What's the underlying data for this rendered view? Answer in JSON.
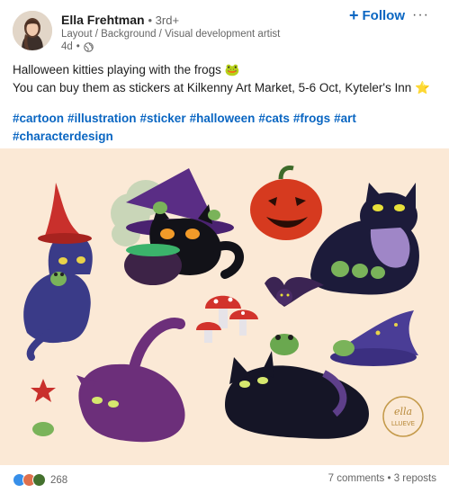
{
  "author": {
    "name": "Ella Frehtman",
    "degree": "3rd+",
    "headline": "Layout / Background / Visual development artist",
    "time": "4d"
  },
  "actions": {
    "follow_label": "Follow",
    "more_label": "···"
  },
  "post": {
    "line1": "Halloween kitties playing with the frogs",
    "line1_emoji": "🐸",
    "line2": "You can buy them as stickers at Kilkenny Art Market, 5-6 Oct, Kyteler's Inn",
    "line2_emoji": "⭐",
    "hashtags": [
      "#cartoon",
      "#illustration",
      "#sticker",
      "#halloween",
      "#cats",
      "#frogs",
      "#art",
      "#characterdesign"
    ]
  },
  "image": {
    "signature_text": "ella LLUEVE",
    "background_color": "#fbe9d6"
  },
  "footer": {
    "reaction_count": "268",
    "comments": "7 comments",
    "separator": " • ",
    "reposts": "3 reposts",
    "reaction_colors": [
      "#378fe9",
      "#df704d",
      "#44712e"
    ]
  }
}
